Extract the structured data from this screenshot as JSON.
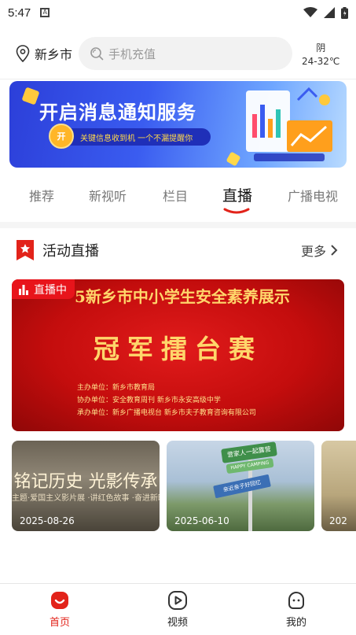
{
  "status_bar": {
    "time": "5:47",
    "notification_icon": "A"
  },
  "header": {
    "location": "新乡市",
    "search_placeholder": "手机充值",
    "weather": {
      "condition": "阴",
      "temperature": "24-32℃"
    }
  },
  "banner": {
    "title": "开启消息通知服务",
    "subtitle": "关键信息收到机 一个不漏提醒你",
    "badge": "开"
  },
  "tabs": [
    {
      "label": "推荐",
      "active": false
    },
    {
      "label": "新视听",
      "active": false
    },
    {
      "label": "栏目",
      "active": false
    },
    {
      "label": "直播",
      "active": true
    },
    {
      "label": "广播电视",
      "active": false
    }
  ],
  "section": {
    "title": "活动直播",
    "more": "更多"
  },
  "live": {
    "badge": "直播中",
    "headline": "5新乡市中小学生安全素养展示",
    "main_title": "冠军擂台赛",
    "info_lines": [
      "主办单位：新乡市教育局",
      "协办单位：安全教育周刊  新乡市永安高级中学",
      "承办单位：新乡广播电视台  新乡市夫子教育咨询有限公司"
    ]
  },
  "videos": [
    {
      "title": "铭记历史  光影传承",
      "subtitle": "主题·爱国主义影片展 ·讲红色故事 ·奋进新时代",
      "date": "2025-08-26"
    },
    {
      "title": "营家人一起露营",
      "subtitle": "HAPPY CAMPING",
      "sign": "亲近亲子好回忆",
      "date": "2025-06-10"
    },
    {
      "date": "202"
    }
  ],
  "bottom_nav": [
    {
      "label": "首页",
      "icon": "home-icon",
      "active": true
    },
    {
      "label": "视频",
      "icon": "video-icon",
      "active": false
    },
    {
      "label": "我的",
      "icon": "profile-icon",
      "active": false
    }
  ],
  "colors": {
    "accent": "#e2231a",
    "live_red": "#c40d0d",
    "banner_blue": "#3a5cf0"
  }
}
